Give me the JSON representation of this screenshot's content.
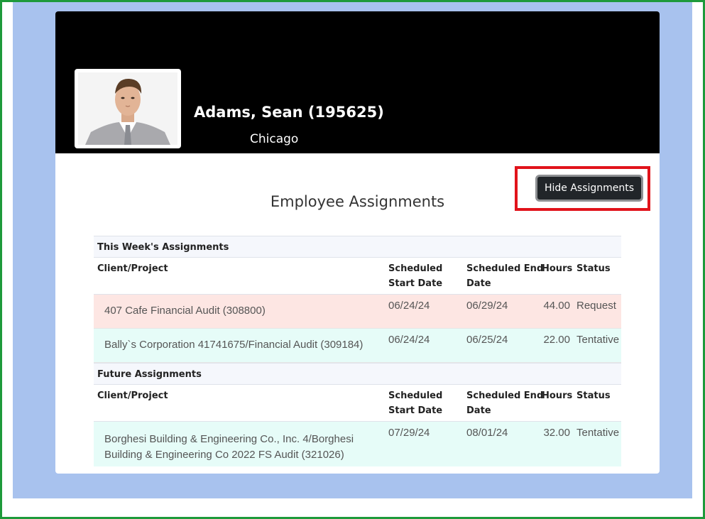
{
  "employee": {
    "name": "Adams, Sean (195625)",
    "location": "Chicago"
  },
  "actions": {
    "hide_assignments_label": "Hide Assignments"
  },
  "section_title": "Employee Assignments",
  "columns": {
    "client_project": "Client/Project",
    "start_line1": "Scheduled",
    "start_line2": "Start Date",
    "end_line1": "Scheduled End",
    "end_line2": "Date",
    "hours": "Hours",
    "status": "Status"
  },
  "groups": [
    {
      "title": "This Week's Assignments",
      "rows": [
        {
          "client": "407 Cafe Financial Audit (308800)",
          "start": "06/24/24",
          "end": "06/29/24",
          "hours": "44.00",
          "status": "Request"
        },
        {
          "client": "Bally`s Corporation 41741675/Financial Audit (309184)",
          "start": "06/24/24",
          "end": "06/25/24",
          "hours": "22.00",
          "status": "Tentative"
        }
      ]
    },
    {
      "title": "Future Assignments",
      "rows": [
        {
          "client_line1": "Borghesi Building & Engineering Co., Inc. 4/Borghesi",
          "client_line2": "Building & Engineering Co 2022 FS Audit (321026)",
          "start": "07/29/24",
          "end": "08/01/24",
          "hours": "32.00",
          "status": "Tentative"
        }
      ]
    }
  ],
  "colors": {
    "frame_border": "#1e9a3a",
    "page_background": "#a8c2ee",
    "header_background": "#000000",
    "highlight_box": "#e1131b",
    "request_row": "#fde6e3",
    "tentative_row": "#e6fcf8",
    "button_background": "#212529"
  },
  "icons": {
    "employee_photo": "employee-photo"
  }
}
